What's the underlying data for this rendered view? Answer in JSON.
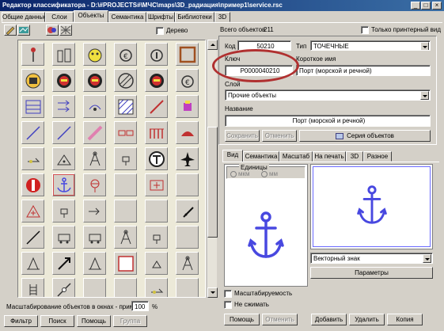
{
  "window": {
    "title": "Редактор классификатора - D:\\#PROJECTS#\\МЧС\\maps\\3D_радиация\\пример1\\service.rsc",
    "controls": [
      "_",
      "□",
      "×"
    ]
  },
  "main_tabs": [
    "Общие данные",
    "Слои",
    "Объекты",
    "Семантика",
    "Шрифты",
    "Библиотеки",
    "3D"
  ],
  "active_main_tab": "Объекты",
  "left": {
    "tree_label": "Дерево",
    "scale_label": "Масштабирование объектов в окнах - примерах",
    "scale_value": "100",
    "scale_unit": "%",
    "buttons": {
      "filter": "Фильтр",
      "search": "Поиск",
      "help": "Помощь",
      "group": "Группа"
    }
  },
  "right": {
    "total_objects_label": "Всего объектов",
    "total_objects_value": "211",
    "print_only_label": "Только принтерный вид",
    "code_label": "Код",
    "code_value": "50210",
    "type_label": "Тип",
    "type_value": "ТОЧЕЧНЫЕ",
    "key_label": "Ключ",
    "key_value": "P0000040210",
    "short_name_label": "Короткое имя",
    "short_name_value": "Порт (морской и речной)",
    "layer_label": "Слой",
    "layer_value": "Прочие объекты",
    "name_label": "Название",
    "name_value": "Порт (морской и речной)",
    "buttons": {
      "save": "Сохранить",
      "cancel": "Отменить",
      "series": "Серия объектов"
    }
  },
  "view_tabs": [
    "Вид",
    "Семантика",
    "Масштаб",
    "На печать",
    "3D",
    "Разное"
  ],
  "active_view_tab": "Вид",
  "view": {
    "units_label": "Единицы",
    "units_options": [
      "мкм",
      "мм"
    ],
    "units_selected": "мкм",
    "sign_type_value": "Векторный знак",
    "params_button": "Параметры",
    "scalable_label": "Масштабируемость",
    "no_compress_label": "Не сжимать",
    "anchor_color": "#4848e0"
  },
  "bottom_buttons": {
    "help": "Помощь",
    "cancel": "Отменить",
    "add": "Добавить",
    "delete": "Удалить",
    "copy": "Копия"
  },
  "symbols": [
    "pin",
    "bottles",
    "warning-face",
    "gear-sign",
    "numbered-i",
    "brown-frame",
    "circle-blocks",
    "red-face",
    "red-face",
    "hatched-circle",
    "red-face",
    "gear-sign",
    "blue-lines",
    "arrows-right",
    "signal",
    "hatched-square",
    "diagonal-fill",
    "small-figures",
    "diagonal-line",
    "diagonal-line",
    "thick-diagonal",
    "brick-row",
    "columns",
    "red-dome",
    "flag-mark",
    "triangle-dots",
    "tower",
    "small-sign",
    "t-circle",
    "airplane",
    "red-circle-bar",
    "anchor",
    "cross-circle",
    "empty",
    "plus-box",
    "empty",
    "triangle-cross",
    "small-sign",
    "arrow-tail",
    "empty",
    "empty",
    "mark-slash",
    "slash-line",
    "truck",
    "truck",
    "tower",
    "small-sign",
    "empty",
    "bell",
    "arrow-diagonal",
    "bell",
    "red-square",
    "triangle-small",
    "tower",
    "ladder",
    "diagonal-point",
    "empty",
    "empty",
    "flag-mark",
    "empty"
  ]
}
